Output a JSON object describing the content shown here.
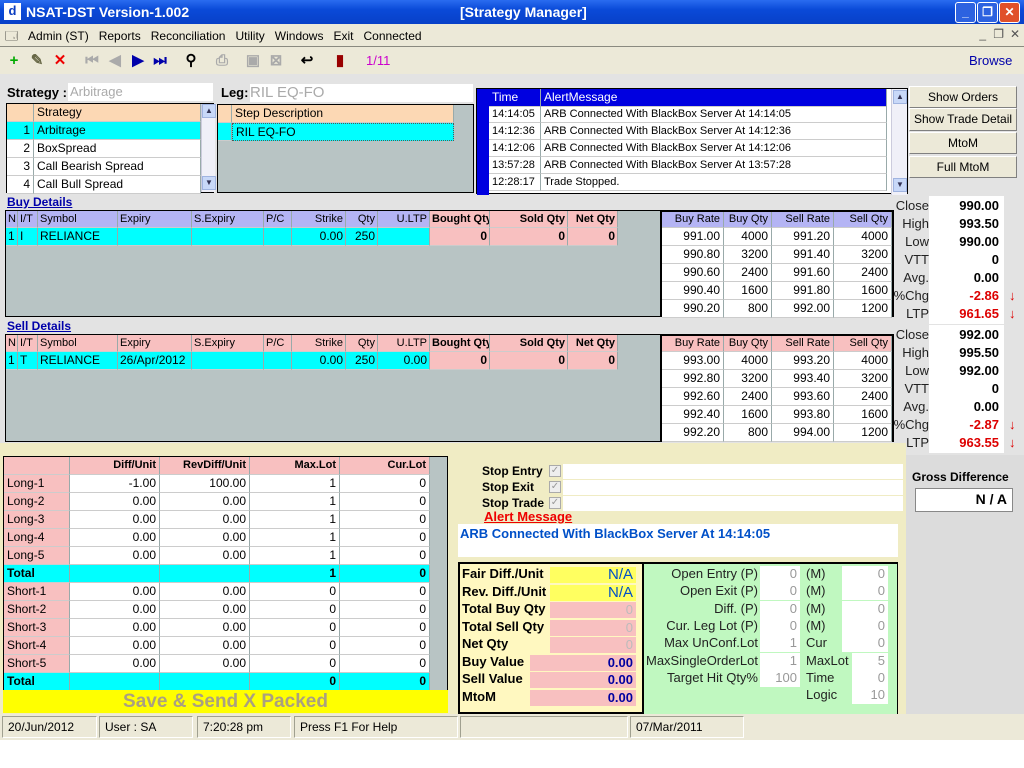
{
  "window": {
    "app_title": "NSAT-DST Version-1.002",
    "window_title": "[Strategy Manager]",
    "icon_letter": "d"
  },
  "menu": [
    "Admin (ST)",
    "Reports",
    "Reconciliation",
    "Utility",
    "Windows",
    "Exit",
    "Connected"
  ],
  "toolbar": {
    "record_counter": "1/11",
    "browse": "Browse"
  },
  "strategy": {
    "label": "Strategy :",
    "value": "Arbitrage",
    "column": "Strategy",
    "rows": [
      {
        "n": "1",
        "name": "Arbitrage"
      },
      {
        "n": "2",
        "name": "BoxSpread"
      },
      {
        "n": "3",
        "name": "Call Bearish Spread"
      },
      {
        "n": "4",
        "name": "Call Bull Spread"
      }
    ]
  },
  "leg": {
    "label": "Leg:",
    "value": "RIL EQ-FO",
    "column": "Step Description",
    "rows": [
      "RIL EQ-FO"
    ]
  },
  "alerts": {
    "columns": [
      "Time",
      "AlertMessage"
    ],
    "rows": [
      [
        "14:14:05",
        "ARB Connected With BlackBox Server At 14:14:05"
      ],
      [
        "14:12:36",
        "ARB Connected With BlackBox Server At 14:12:36"
      ],
      [
        "14:12:06",
        "ARB Connected With BlackBox Server At 14:12:06"
      ],
      [
        "13:57:28",
        "ARB Connected With BlackBox Server At 13:57:28"
      ],
      [
        "12:28:17",
        "Trade Stopped."
      ]
    ]
  },
  "actions": [
    "Show Orders",
    "Show Trade Detail",
    "MtoM",
    "Full MtoM"
  ],
  "legs_columns": [
    "N",
    "I/T",
    "Symbol",
    "Expiry",
    "S.Expiry",
    "P/C",
    "Strike",
    "Qty",
    "U.LTP",
    "Bought Qty",
    "Sold Qty",
    "Net Qty"
  ],
  "depth_columns": [
    "Buy Rate",
    "Buy Qty",
    "Sell Rate",
    "Sell Qty"
  ],
  "quote_labels": [
    "Close",
    "High",
    "Low",
    "VTT",
    "Avg.",
    "%Chg",
    "LTP"
  ],
  "buy": {
    "title": "Buy Details",
    "row": [
      "1",
      "I",
      "RELIANCE",
      "",
      "",
      "",
      "0.00",
      "250",
      "",
      "0",
      "0",
      "0"
    ],
    "depth": [
      [
        "991.00",
        "4000",
        "991.20",
        "4000"
      ],
      [
        "990.80",
        "3200",
        "991.40",
        "3200"
      ],
      [
        "990.60",
        "2400",
        "991.60",
        "2400"
      ],
      [
        "990.40",
        "1600",
        "991.80",
        "1600"
      ],
      [
        "990.20",
        "800",
        "992.00",
        "1200"
      ]
    ],
    "quote": [
      "990.00",
      "993.50",
      "990.00",
      "0",
      "0.00",
      "-2.86",
      "961.65"
    ]
  },
  "sell": {
    "title": "Sell Details",
    "row": [
      "1",
      "T",
      "RELIANCE",
      "26/Apr/2012",
      "",
      "",
      "0.00",
      "250",
      "0.00",
      "0",
      "0",
      "0"
    ],
    "depth": [
      [
        "993.00",
        "4000",
        "993.20",
        "4000"
      ],
      [
        "992.80",
        "3200",
        "993.40",
        "3200"
      ],
      [
        "992.60",
        "2400",
        "993.60",
        "2400"
      ],
      [
        "992.40",
        "1600",
        "993.80",
        "1600"
      ],
      [
        "992.20",
        "800",
        "994.00",
        "1200"
      ]
    ],
    "quote": [
      "992.00",
      "995.50",
      "992.00",
      "0",
      "0.00",
      "-2.87",
      "963.55"
    ]
  },
  "lots": {
    "columns": [
      "",
      "Diff/Unit",
      "RevDiff/Unit",
      "Max.Lot",
      "Cur.Lot"
    ],
    "rows": [
      [
        "Long-1",
        "-1.00",
        "100.00",
        "1",
        "0"
      ],
      [
        "Long-2",
        "0.00",
        "0.00",
        "1",
        "0"
      ],
      [
        "Long-3",
        "0.00",
        "0.00",
        "1",
        "0"
      ],
      [
        "Long-4",
        "0.00",
        "0.00",
        "1",
        "0"
      ],
      [
        "Long-5",
        "0.00",
        "0.00",
        "1",
        "0"
      ],
      [
        "Total",
        "",
        "",
        "1",
        "0"
      ],
      [
        "Short-1",
        "0.00",
        "0.00",
        "0",
        "0"
      ],
      [
        "Short-2",
        "0.00",
        "0.00",
        "0",
        "0"
      ],
      [
        "Short-3",
        "0.00",
        "0.00",
        "0",
        "0"
      ],
      [
        "Short-4",
        "0.00",
        "0.00",
        "0",
        "0"
      ],
      [
        "Short-5",
        "0.00",
        "0.00",
        "0",
        "0"
      ],
      [
        "Total",
        "",
        "",
        "0",
        "0"
      ]
    ],
    "save_button": "Save & Send X Packed"
  },
  "stops": [
    {
      "label": "Stop Entry",
      "checked": true
    },
    {
      "label": "Stop Exit",
      "checked": true
    },
    {
      "label": "Stop Trade",
      "checked": true
    }
  ],
  "alert_message": {
    "label": "Alert Message",
    "text": "ARB Connected With BlackBox Server At 14:14:05"
  },
  "summary": [
    {
      "label": "Fair Diff./Unit",
      "value": "N/A"
    },
    {
      "label": "Rev. Diff./Unit",
      "value": "N/A"
    },
    {
      "label": "Total Buy Qty",
      "value": "0"
    },
    {
      "label": "Total Sell Qty",
      "value": "0"
    },
    {
      "label": "Net Qty",
      "value": "0"
    },
    {
      "label": "Buy Value",
      "value": "0.00"
    },
    {
      "label": "Sell Value",
      "value": "0.00"
    },
    {
      "label": "MtoM",
      "value": "0.00"
    }
  ],
  "stats": [
    {
      "label": "Open Entry (P)",
      "value": "0",
      "label2": "(M)",
      "value2": "0"
    },
    {
      "label": "Open Exit (P)",
      "value": "0",
      "label2": "(M)",
      "value2": "0"
    },
    {
      "label": "Diff. (P)",
      "value": "0",
      "label2": "(M)",
      "value2": "0"
    },
    {
      "label": "Cur. Leg Lot (P)",
      "value": "0",
      "label2": "(M)",
      "value2": "0"
    },
    {
      "label": "Max UnConf.Lot",
      "value": "1",
      "label2": "Cur",
      "value2": "0"
    },
    {
      "label": "MaxSingleOrderLot",
      "value": "1",
      "label2": "MaxLot",
      "value2": "5"
    },
    {
      "label": "Target Hit Qty%",
      "value": "100",
      "label2": "Time",
      "value2": "0"
    },
    {
      "label": "",
      "value": "",
      "label2": "Logic",
      "value2": "10"
    }
  ],
  "gross_difference": {
    "label": "Gross Difference",
    "value": "N / A"
  },
  "statusbar": [
    "20/Jun/2012",
    "User : SA",
    "7:20:28 pm",
    "Press F1 For Help",
    "",
    "07/Mar/2011"
  ],
  "colors": {
    "cyan": "#00ffff",
    "pink": "#f8c0c0",
    "lavender": "#b4b4f4",
    "yellow": "#ffff00",
    "green": "#c0f8c0",
    "down_red": "#dd0000"
  }
}
